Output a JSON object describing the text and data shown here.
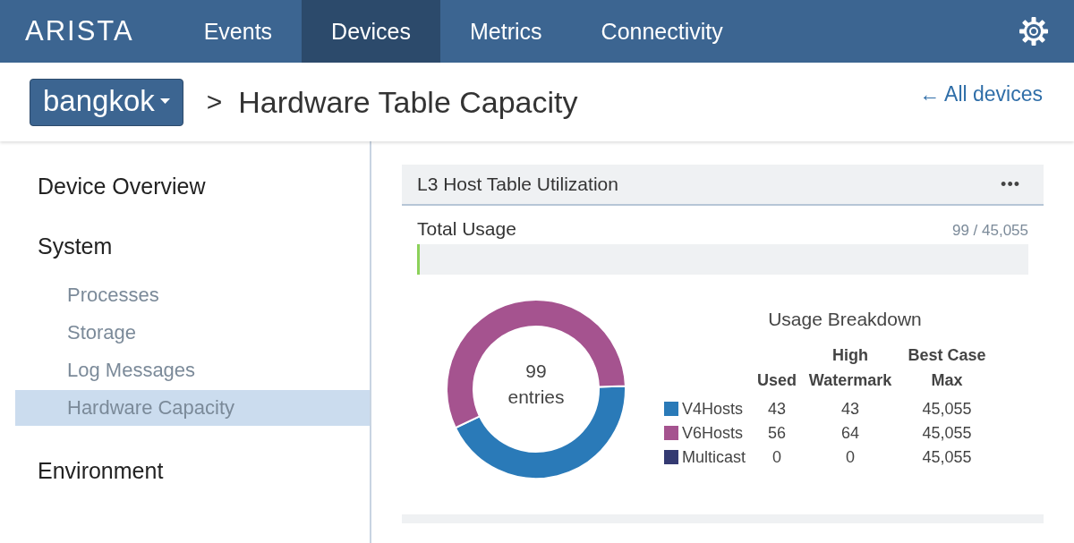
{
  "nav": {
    "logo": "ARISTA",
    "tabs": [
      {
        "label": "Events",
        "selected": false
      },
      {
        "label": "Devices",
        "selected": true
      },
      {
        "label": "Metrics",
        "selected": false
      },
      {
        "label": "Connectivity",
        "selected": false
      }
    ]
  },
  "breadcrumb": {
    "device": "bangkok",
    "separator": ">",
    "title": "Hardware Table Capacity",
    "back_link": "← All devices"
  },
  "sidebar": {
    "items": [
      {
        "label": "Device Overview",
        "selected": false
      },
      {
        "label": "System",
        "selected": false,
        "children": [
          {
            "label": "Processes",
            "selected": false
          },
          {
            "label": "Storage",
            "selected": false
          },
          {
            "label": "Log Messages",
            "selected": false
          },
          {
            "label": "Hardware Capacity",
            "selected": true
          }
        ]
      },
      {
        "label": "Environment",
        "selected": false
      }
    ]
  },
  "card": {
    "title": "L3 Host Table Utilization",
    "menu": "•••",
    "total": {
      "label": "Total Usage",
      "reading": "99 / 45,055",
      "level": 0.004
    },
    "donut": {
      "value": "99",
      "unit": "entries"
    },
    "breakdown": {
      "title": "Usage Breakdown",
      "columns": [
        "Used",
        "High Watermark",
        "Best Case Max"
      ],
      "rows": [
        {
          "name": "V4Hosts",
          "color": "#2a7ab8",
          "used": "43",
          "high_watermark": "43",
          "best_case_max": "45,055"
        },
        {
          "name": "V6Hosts",
          "color": "#a5538f",
          "used": "56",
          "high_watermark": "64",
          "best_case_max": "45,055"
        },
        {
          "name": "Multicast",
          "color": "#343a72",
          "used": "0",
          "high_watermark": "0",
          "best_case_max": "45,055"
        }
      ]
    }
  }
}
